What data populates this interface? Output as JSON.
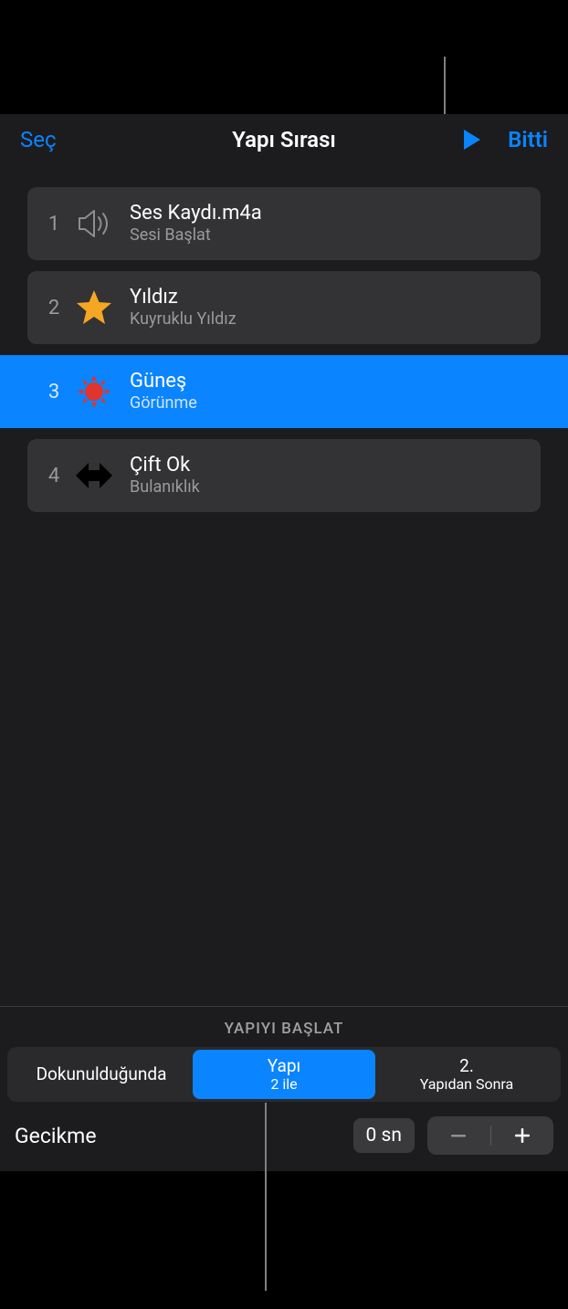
{
  "header": {
    "select_label": "Seç",
    "title": "Yapı Sırası",
    "done_label": "Bitti"
  },
  "items": [
    {
      "num": "1",
      "icon": "speaker",
      "title": "Ses Kaydı.m4a",
      "sub": "Sesi Başlat",
      "selected": false
    },
    {
      "num": "2",
      "icon": "star",
      "title": "Yıldız",
      "sub": "Kuyruklu Yıldız",
      "selected": false
    },
    {
      "num": "3",
      "icon": "sun",
      "title": "Güneş",
      "sub": "Görünme",
      "selected": true
    },
    {
      "num": "4",
      "icon": "double-arrow",
      "title": "Çift Ok",
      "sub": "Bulanıklık",
      "selected": false
    }
  ],
  "start": {
    "section_title": "YAPIYI BAŞLAT",
    "options": [
      {
        "line1": "Dokunulduğunda",
        "line2": ""
      },
      {
        "line1": "Yapı",
        "line2": "2 ile"
      },
      {
        "line1": "2.",
        "line2": "Yapıdan Sonra"
      }
    ],
    "selected_index": 1
  },
  "delay": {
    "label": "Gecikme",
    "value": "0 sn"
  }
}
